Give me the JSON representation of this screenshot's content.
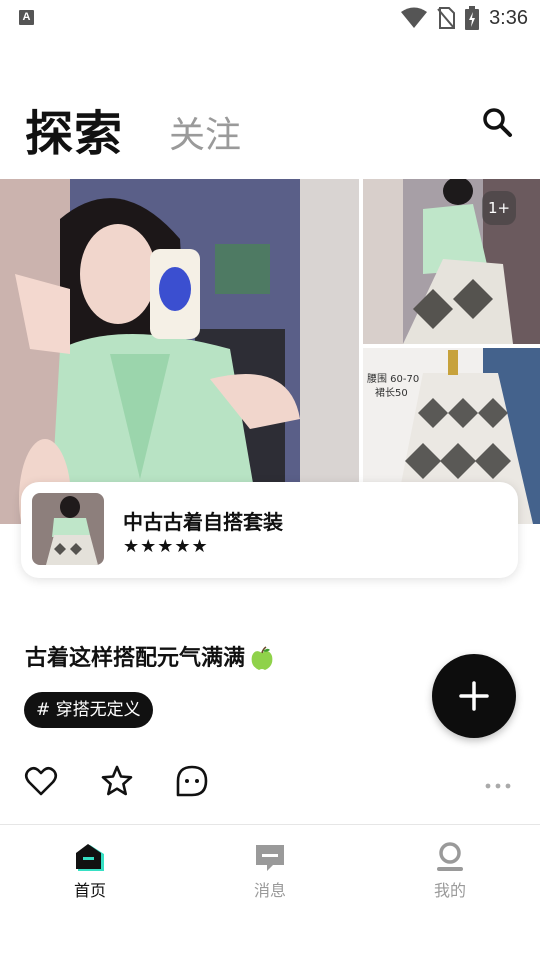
{
  "status_bar": {
    "time": "3:36",
    "notification_icon": "a-box-icon"
  },
  "header": {
    "tab_explore": "探索",
    "tab_follow": "关注"
  },
  "post": {
    "images_more_badge": "1+",
    "image_tag_lines": [
      "腰围 60-70",
      "裙长50"
    ],
    "product": {
      "name": "中古古着自搭套装",
      "stars": "★★★★★"
    },
    "title": "古着这样搭配元气满满",
    "hashtag": "# 穿搭无定义"
  },
  "bottom_nav": [
    {
      "label": "首页",
      "active": true
    },
    {
      "label": "消息",
      "active": false
    },
    {
      "label": "我的",
      "active": false
    }
  ],
  "colors": {
    "accent": "#37e0c4",
    "text": "#111111",
    "inactive": "#9a9a9a"
  }
}
